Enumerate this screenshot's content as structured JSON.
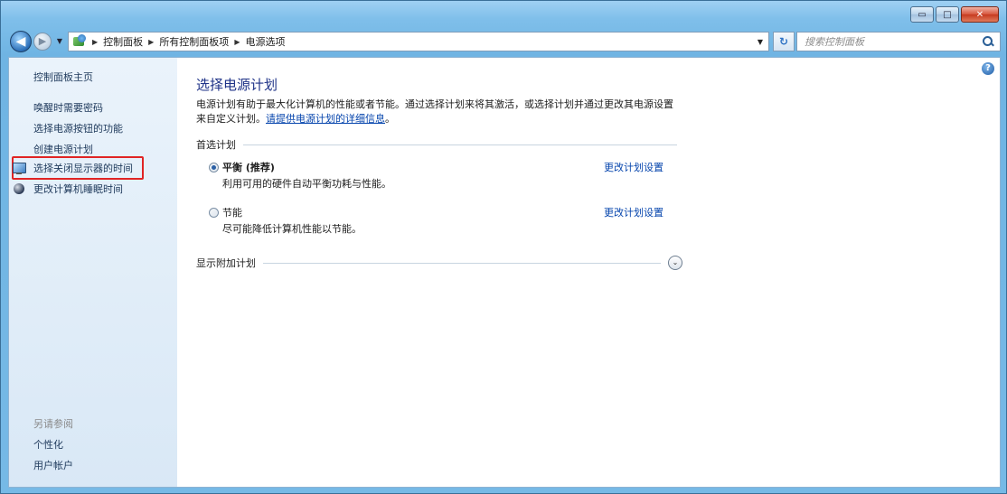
{
  "window": {
    "minimize_symbol": "▭",
    "maximize_symbol": "□",
    "close_symbol": "✕"
  },
  "nav": {
    "back_symbol": "◀",
    "forward_symbol": "▶",
    "history_symbol": "▼",
    "breadcrumbs": [
      "控制面板",
      "所有控制面板项",
      "电源选项"
    ],
    "breadcrumb_separator": "▶",
    "address_dropdown_symbol": "▼",
    "refresh_symbol": "↻",
    "search_placeholder": "搜索控制面板"
  },
  "sidebar": {
    "home": "控制面板主页",
    "tasks": [
      {
        "label": "唤醒时需要密码"
      },
      {
        "label": "选择电源按钮的功能"
      },
      {
        "label": "创建电源计划"
      },
      {
        "label": "选择关闭显示器的时间",
        "icon": "monitor-icon",
        "highlighted": true
      },
      {
        "label": "更改计算机睡眠时间",
        "icon": "moon-icon"
      }
    ],
    "see_also": {
      "title": "另请参阅",
      "links": [
        "个性化",
        "用户帐户"
      ]
    }
  },
  "main": {
    "help_symbol": "?",
    "title": "选择电源计划",
    "description_line1": "电源计划有助于最大化计算机的性能或者节能。通过选择计划来将其激活，或选择计划并通过更改其电源设置",
    "description_line2_prefix": "来自定义计划。",
    "description_link": "请提供电源计划的详细信息",
    "description_suffix": "。",
    "preferred_plans_label": "首选计划",
    "plans": [
      {
        "name": "平衡 (推荐)",
        "description": "利用可用的硬件自动平衡功耗与性能。",
        "link": "更改计划设置",
        "selected": true
      },
      {
        "name": "节能",
        "description": "尽可能降低计算机性能以节能。",
        "link": "更改计划设置",
        "selected": false
      }
    ],
    "additional_plans_label": "显示附加计划",
    "expand_symbol": "⌄"
  }
}
